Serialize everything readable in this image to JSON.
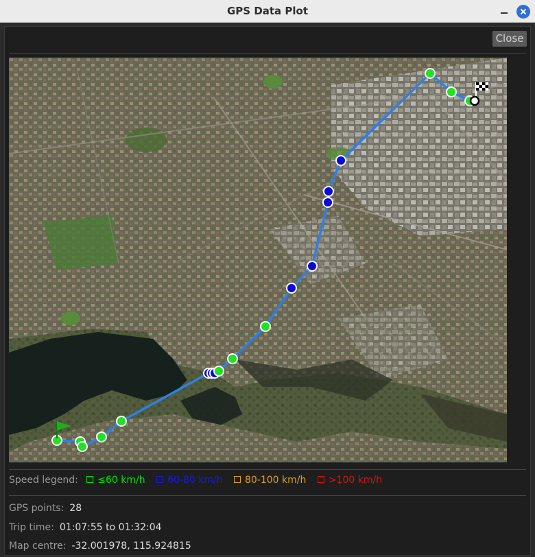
{
  "window": {
    "title": "GPS Data Plot"
  },
  "toolbar": {
    "close_label": "Close"
  },
  "legend": {
    "label": "Speed legend:",
    "items": [
      {
        "label": "≤60 km/h",
        "color": "#00e000"
      },
      {
        "label": "60-80 km/h",
        "color": "#1a1ad8"
      },
      {
        "label": "80-100 km/h",
        "color": "#e0a020"
      },
      {
        "label": ">100 km/h",
        "color": "#e01010"
      }
    ]
  },
  "info": {
    "gps_points_label": "GPS points:",
    "gps_points_value": "28",
    "trip_time_label": "Trip time:",
    "trip_time_value": "01:07:55 to 01:32:04",
    "map_centre_label": "Map centre:",
    "map_centre_value": "-32.001978, 115.924815"
  },
  "map": {
    "route_color": "#2f7fe6",
    "point_colors": {
      "slow": "#22e022",
      "medium": "#0a0ad8"
    },
    "points": [
      {
        "speed": "slow"
      },
      {
        "speed": "slow"
      },
      {
        "speed": "slow"
      },
      {
        "speed": "slow"
      },
      {
        "speed": "slow"
      },
      {
        "speed": "medium"
      },
      {
        "speed": "medium"
      },
      {
        "speed": "medium"
      },
      {
        "speed": "slow"
      },
      {
        "speed": "slow"
      },
      {
        "speed": "slow"
      },
      {
        "speed": "medium"
      },
      {
        "speed": "medium"
      },
      {
        "speed": "medium"
      },
      {
        "speed": "medium"
      },
      {
        "speed": "medium"
      },
      {
        "speed": "slow"
      },
      {
        "speed": "slow"
      },
      {
        "speed": "slow"
      }
    ]
  }
}
